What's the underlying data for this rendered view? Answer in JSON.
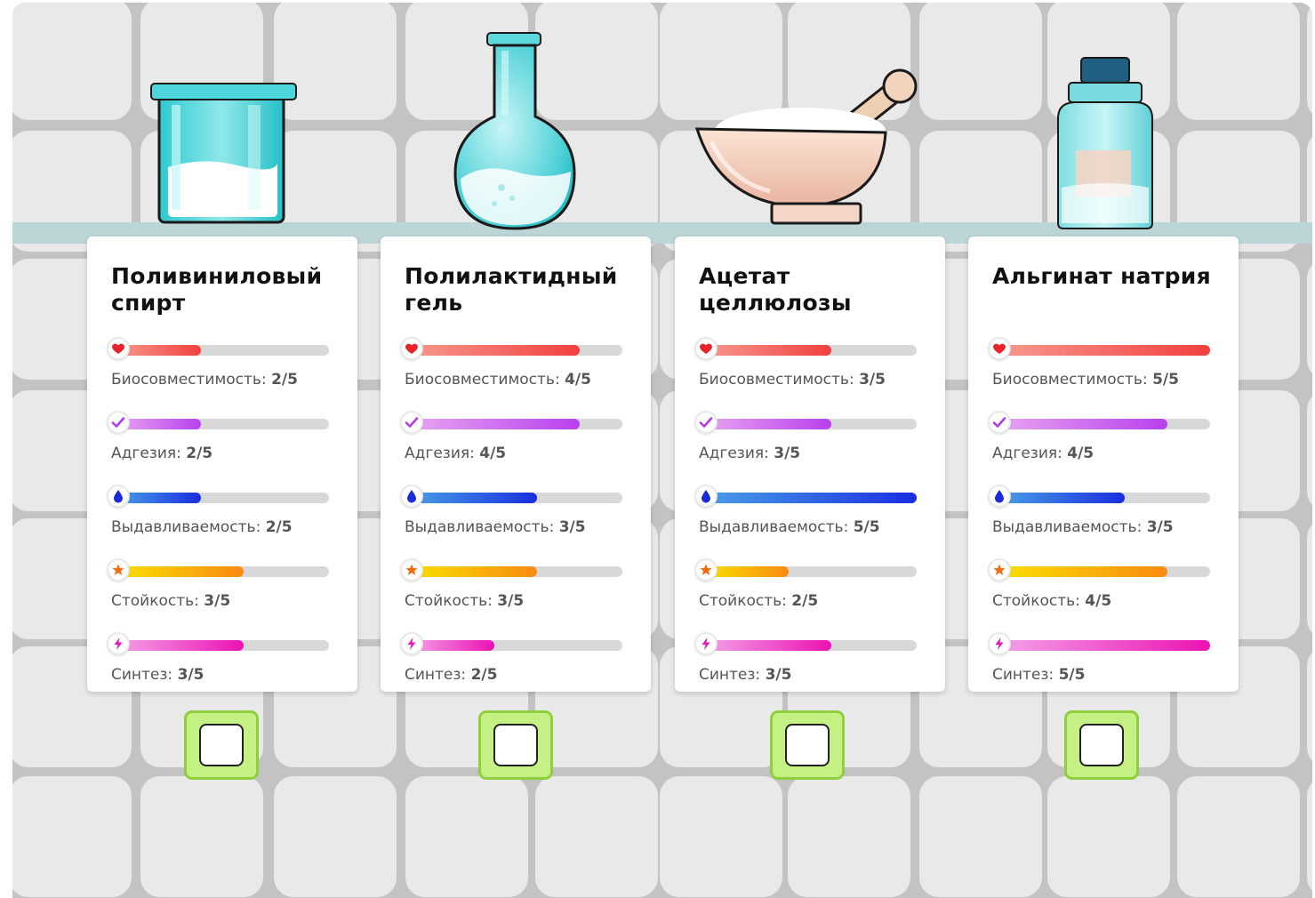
{
  "colors": {
    "background_tiles": "#e9e9e9",
    "grout": "#c3c3c3",
    "shelf": "#bcd5d6",
    "checkbox_frame": "#c4f084",
    "checkbox_border": "#8fcf3d"
  },
  "stat_types": [
    {
      "key": "bio",
      "icon": "heart-icon",
      "gradient": [
        "#f79a8f",
        "#f1403f"
      ],
      "icon_color": "#e8232a"
    },
    {
      "key": "adh",
      "icon": "check-icon",
      "gradient": [
        "#e7a6f0",
        "#b840ee"
      ],
      "icon_color": "#b23be6"
    },
    {
      "key": "ext",
      "icon": "drop-icon",
      "gradient": [
        "#4aa0e8",
        "#1a2ddf"
      ],
      "icon_color": "#1c2bd8"
    },
    {
      "key": "dur",
      "icon": "star-icon",
      "gradient": [
        "#f9e100",
        "#f98a12"
      ],
      "icon_color": "#f36b12"
    },
    {
      "key": "syn",
      "icon": "lightning-icon",
      "gradient": [
        "#f3a4e8",
        "#ec11b3"
      ],
      "icon_color": "#e51ab6"
    }
  ],
  "materials": [
    {
      "name": "Поливиниловый спирт",
      "vessel": "beaker-icon",
      "stats": [
        {
          "label": "Биосовместимость:",
          "value": "2/5",
          "level": 2
        },
        {
          "label": "Адгезия:",
          "value": "2/5",
          "level": 2
        },
        {
          "label": "Выдавливаемость:",
          "value": "2/5",
          "level": 2
        },
        {
          "label": "Стойкость:",
          "value": "3/5",
          "level": 3
        },
        {
          "label": "Синтез:",
          "value": "3/5",
          "level": 3
        }
      ]
    },
    {
      "name": "Полилактидный гель",
      "vessel": "flask-icon",
      "stats": [
        {
          "label": "Биосовместимость:",
          "value": "4/5",
          "level": 4
        },
        {
          "label": "Адгезия:",
          "value": "4/5",
          "level": 4
        },
        {
          "label": "Выдавливаемость:",
          "value": "3/5",
          "level": 3
        },
        {
          "label": "Стойкость:",
          "value": "3/5",
          "level": 3
        },
        {
          "label": "Синтез:",
          "value": "2/5",
          "level": 2
        }
      ]
    },
    {
      "name": "Ацетат целлюлозы",
      "vessel": "mortar-pestle-icon",
      "stats": [
        {
          "label": "Биосовместимость:",
          "value": "3/5",
          "level": 3
        },
        {
          "label": "Адгезия:",
          "value": "3/5",
          "level": 3
        },
        {
          "label": "Выдавливаемость:",
          "value": "5/5",
          "level": 5
        },
        {
          "label": "Стойкость:",
          "value": "2/5",
          "level": 2
        },
        {
          "label": "Синтез:",
          "value": "3/5",
          "level": 3
        }
      ]
    },
    {
      "name": "Альгинат натрия",
      "vessel": "jar-icon",
      "stats": [
        {
          "label": "Биосовместимость:",
          "value": "5/5",
          "level": 5
        },
        {
          "label": "Адгезия:",
          "value": "4/5",
          "level": 4
        },
        {
          "label": "Выдавливаемость:",
          "value": "3/5",
          "level": 3
        },
        {
          "label": "Стойкость:",
          "value": "4/5",
          "level": 4
        },
        {
          "label": "Синтез:",
          "value": "5/5",
          "level": 5
        }
      ]
    }
  ]
}
